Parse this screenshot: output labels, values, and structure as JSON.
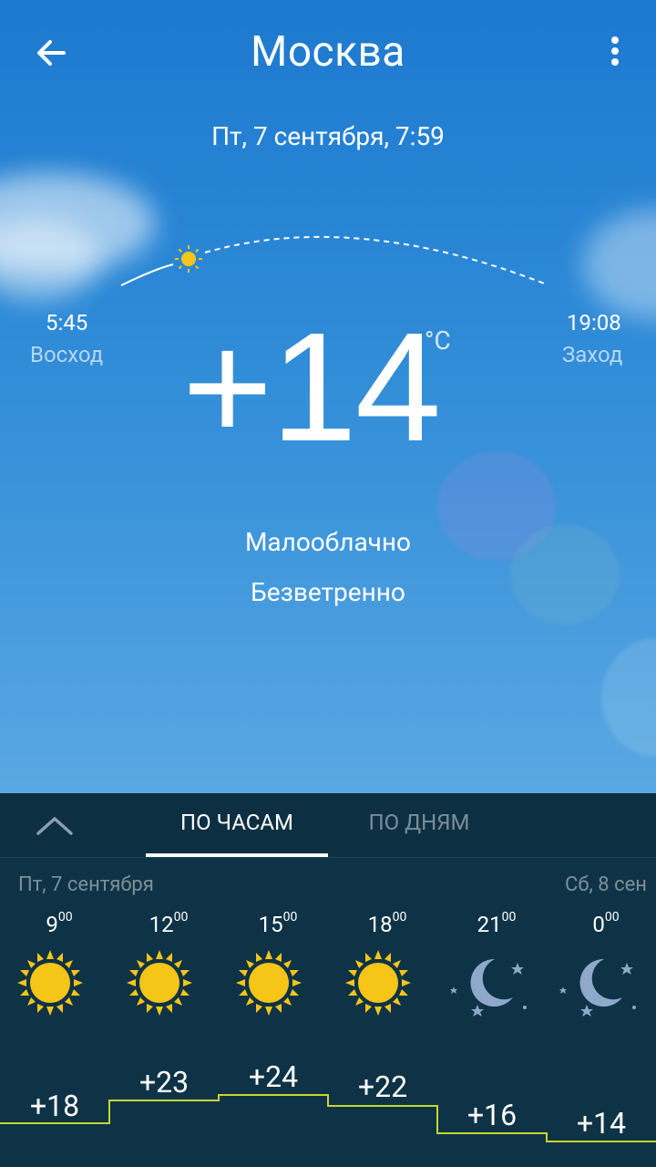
{
  "header": {
    "city": "Москва",
    "date": "Пт, 7 сентября, 7:59"
  },
  "sun": {
    "sunrise_time": "5:45",
    "sunrise_label": "Восход",
    "sunset_time": "19:08",
    "sunset_label": "Заход"
  },
  "current": {
    "temperature": "+14",
    "unit": "°C",
    "condition": "Малооблачно",
    "wind": "Безветренно"
  },
  "tabs": {
    "hourly": "ПО ЧАСАМ",
    "daily": "ПО ДНЯМ"
  },
  "forecast": {
    "day_left": "Пт, 7 сентября",
    "day_right": "Сб, 8 сен",
    "hours": [
      {
        "hour": "9",
        "min": "00",
        "temp": "+18",
        "icon": "sun-icon"
      },
      {
        "hour": "12",
        "min": "00",
        "temp": "+23",
        "icon": "sun-icon"
      },
      {
        "hour": "15",
        "min": "00",
        "temp": "+24",
        "icon": "sun-icon"
      },
      {
        "hour": "18",
        "min": "00",
        "temp": "+22",
        "icon": "sun-icon"
      },
      {
        "hour": "21",
        "min": "00",
        "temp": "+16",
        "icon": "moon-icon"
      },
      {
        "hour": "0",
        "min": "00",
        "temp": "+14",
        "icon": "moon-icon"
      }
    ]
  },
  "colors": {
    "sun": "#f5c518",
    "temp_line": "#c8d530",
    "moon": "#8ea9c9"
  }
}
